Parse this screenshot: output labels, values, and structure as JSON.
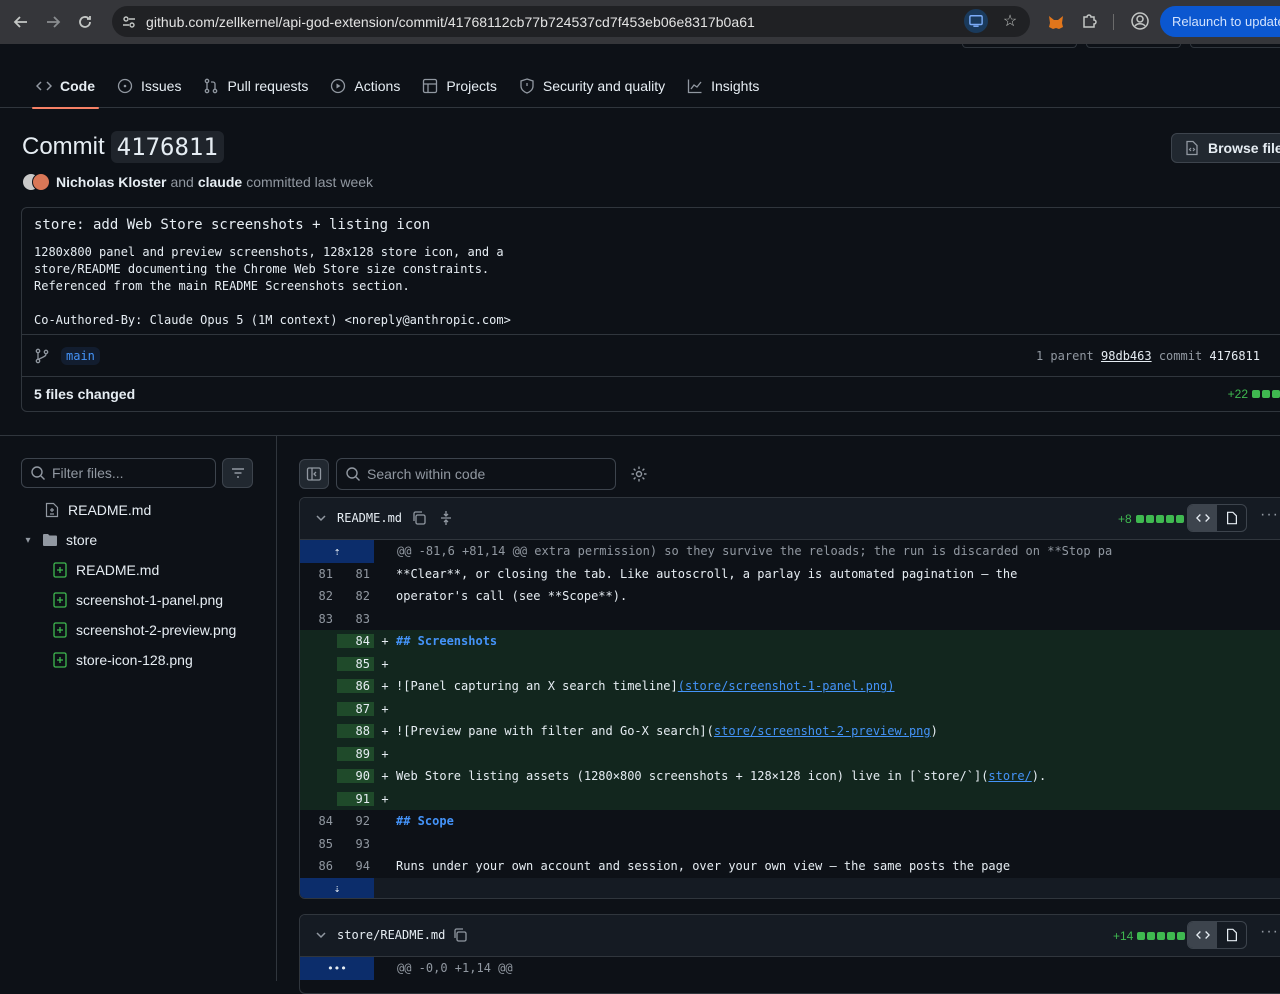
{
  "browser": {
    "url": "github.com/zellkernel/api-god-extension/commit/41768112cb77b724537cd7f453eb06e8317b0a61",
    "relaunch_label": "Relaunch to update"
  },
  "repo_nav": {
    "tabs": [
      {
        "label": "Code",
        "icon": "code-icon"
      },
      {
        "label": "Issues",
        "icon": "issue-icon"
      },
      {
        "label": "Pull requests",
        "icon": "pull-request-icon"
      },
      {
        "label": "Actions",
        "icon": "play-icon"
      },
      {
        "label": "Projects",
        "icon": "table-icon"
      },
      {
        "label": "Security and quality",
        "icon": "shield-icon"
      },
      {
        "label": "Insights",
        "icon": "graph-icon"
      }
    ]
  },
  "commit": {
    "title_prefix": "Commit",
    "short_sha": "4176811",
    "browse_label": "Browse files",
    "author1": "Nicholas Kloster",
    "and": "and",
    "author2": "claude",
    "committed": "committed last week",
    "message_title": "store: add Web Store screenshots + listing icon",
    "message_body": "1280x800 panel and preview screenshots, 128x128 store icon, and a\nstore/README documenting the Chrome Web Store size constraints.\nReferenced from the main README Screenshots section.\n\nCo-Authored-By: Claude Opus 5 (1M context) <noreply@anthropic.com>",
    "branch": "main",
    "parent_prefix": "1 parent",
    "parent_sha": "98db463",
    "commit_word": "commit",
    "commit_sha": "4176811",
    "files_changed": "5 files changed",
    "additions_total": "+22"
  },
  "file_tree": {
    "filter_placeholder": "Filter files...",
    "items": [
      {
        "name": "README.md",
        "type": "file-modified"
      },
      {
        "name": "store",
        "type": "folder"
      },
      {
        "name": "README.md",
        "type": "file-added"
      },
      {
        "name": "screenshot-1-panel.png",
        "type": "file-added"
      },
      {
        "name": "screenshot-2-preview.png",
        "type": "file-added"
      },
      {
        "name": "store-icon-128.png",
        "type": "file-added"
      }
    ]
  },
  "diff_toolbar": {
    "search_placeholder": "Search within code"
  },
  "diffs": [
    {
      "filename": "README.md",
      "stat": "+8",
      "hunk": "@@ -81,6 +81,14 @@ extra permission) so they survive the reloads; the run is discarded on **Stop pa",
      "lines": [
        {
          "old": "81",
          "new": "81",
          "sign": " ",
          "code": "**Clear**, or closing the tab. Like autoscroll, a parlay is automated pagination — the"
        },
        {
          "old": "82",
          "new": "82",
          "sign": " ",
          "code": "operator's call (see **Scope**)."
        },
        {
          "old": "83",
          "new": "83",
          "sign": " ",
          "code": ""
        },
        {
          "old": "",
          "new": "84",
          "sign": "+",
          "code_h": "## Screenshots"
        },
        {
          "old": "",
          "new": "85",
          "sign": "+",
          "code": ""
        },
        {
          "old": "",
          "new": "86",
          "sign": "+",
          "code_a": "![Panel capturing an X search timeline]",
          "code_link": "(store/screenshot-1-panel.png)"
        },
        {
          "old": "",
          "new": "87",
          "sign": "+",
          "code": ""
        },
        {
          "old": "",
          "new": "88",
          "sign": "+",
          "code_a": "![Preview pane with filter and Go-X search](",
          "code_link": "store/screenshot-2-preview.png",
          "code_b": ")"
        },
        {
          "old": "",
          "new": "89",
          "sign": "+",
          "code": ""
        },
        {
          "old": "",
          "new": "90",
          "sign": "+",
          "code_a": "Web Store listing assets (1280×800 screenshots + 128×128 icon) live in [`store/`](",
          "code_link": "store/",
          "code_b": ")."
        },
        {
          "old": "",
          "new": "91",
          "sign": "+",
          "code": ""
        },
        {
          "old": "84",
          "new": "92",
          "sign": " ",
          "code_h": "## Scope"
        },
        {
          "old": "85",
          "new": "93",
          "sign": " ",
          "code": ""
        },
        {
          "old": "86",
          "new": "94",
          "sign": " ",
          "code": "Runs under your own account and session, over your own view — the same posts the page"
        }
      ]
    },
    {
      "filename": "store/README.md",
      "stat": "+14",
      "hunk": "@@ -0,0 +1,14 @@"
    }
  ]
}
